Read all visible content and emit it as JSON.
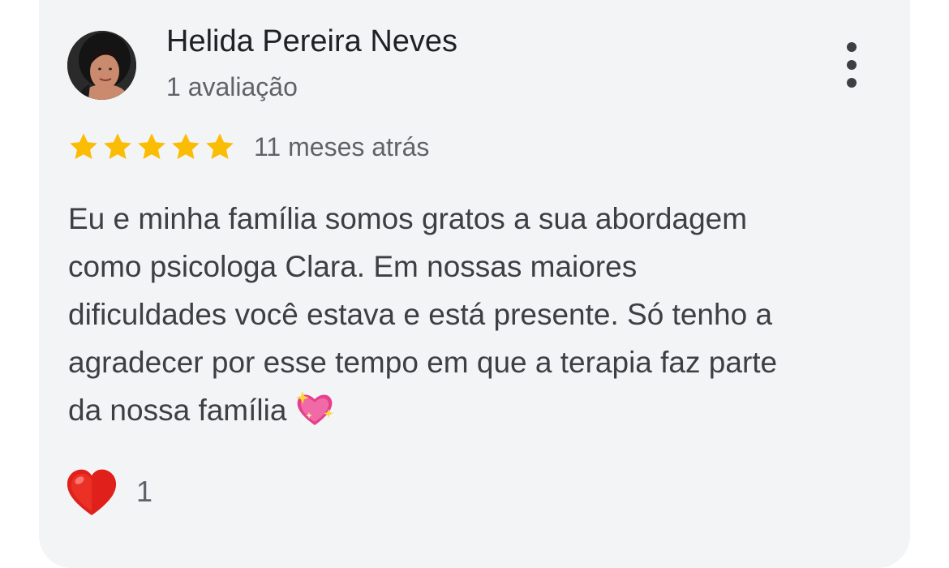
{
  "review": {
    "author_name": "Helida Pereira Neves",
    "author_review_count": "1 avaliação",
    "rating": 5,
    "rating_max": 5,
    "time_ago": "11 meses atrás",
    "text_lines": [
      "Eu e minha família somos gratos a sua abordagem",
      "como psicologa Clara. Em nossas maiores",
      "dificuldades você estava e está presente. Só tenho a",
      "agradecer por esse tempo em que a terapia faz parte",
      "da nossa família"
    ],
    "text_emoji": "sparkling-heart-icon",
    "reaction": {
      "icon": "red-heart-icon",
      "count": "1"
    }
  },
  "colors": {
    "card_background": "#f3f4f6",
    "star": "#fbbc04",
    "primary_text": "#202124",
    "secondary_text": "#5f6368"
  }
}
